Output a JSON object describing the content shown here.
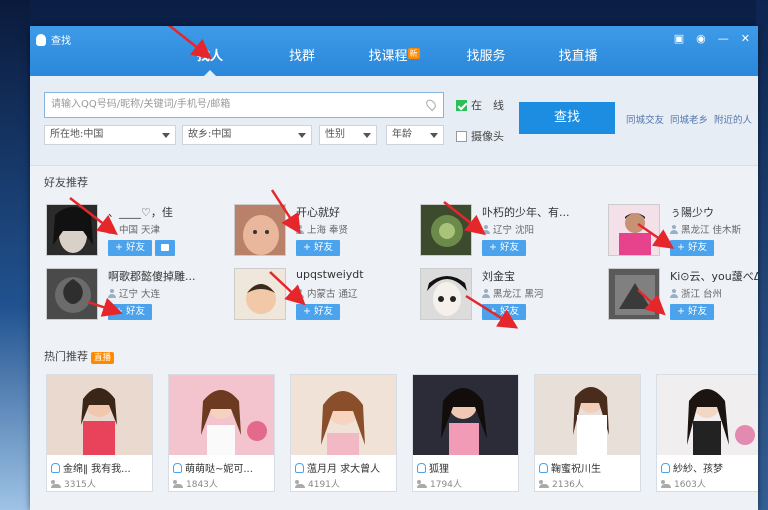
{
  "app": {
    "title": "查找"
  },
  "window_controls": [
    "▣",
    "◉",
    "—",
    "✕"
  ],
  "tabs": [
    {
      "label": "找人",
      "active": true
    },
    {
      "label": "找群",
      "active": false
    },
    {
      "label": "找课程",
      "active": false,
      "badge": "新"
    },
    {
      "label": "找服务",
      "active": false
    },
    {
      "label": "找直播",
      "active": false
    }
  ],
  "search": {
    "placeholder": "请输入QQ号码/昵称/关键词/手机号/邮箱",
    "location_select": "所在地:中国",
    "hometown_select": "故乡:中国",
    "gender_select": "性别",
    "age_select": "年龄",
    "online_label": "在　线",
    "online_checked": true,
    "camera_label": "摄像头",
    "camera_checked": false,
    "find_button": "查找",
    "quick_links": [
      "同城交友",
      "同城老乡",
      "附近的人"
    ]
  },
  "friends_section": {
    "title": "好友推荐",
    "add_label": "+ 好友",
    "friends": [
      {
        "name": "、____♡，佳",
        "location": "中国 天津",
        "has_msg": true
      },
      {
        "name": "开心就好",
        "location": "上海 奉贤",
        "has_msg": false
      },
      {
        "name": "卟朽的少年、有...",
        "location": "辽宁 沈阳",
        "has_msg": false
      },
      {
        "name": "ぅ陽少ウ",
        "location": "黑龙江 佳木斯",
        "has_msg": false
      },
      {
        "name": "啊歌郡懿傻掉雕...",
        "location": "辽宁 大连",
        "has_msg": false
      },
      {
        "name": "upqstweiydt",
        "location": "内蒙古 通辽",
        "has_msg": false
      },
      {
        "name": "刘金宝",
        "location": "黑龙江 黑河",
        "has_msg": false
      },
      {
        "name": "Ki⊙云、you蘐べΔ",
        "location": "浙江 台州",
        "has_msg": false
      }
    ]
  },
  "hot_section": {
    "title": "热门推荐",
    "badge": "直播",
    "items": [
      {
        "name": "金绵‖ 我有我...",
        "count": "3315人"
      },
      {
        "name": "萌萌哒~妮可...",
        "count": "1843人"
      },
      {
        "name": "蕰月月 求大曾人",
        "count": "4191人"
      },
      {
        "name": "狐狸",
        "count": "1794人"
      },
      {
        "name": "鞠蜜祝川生",
        "count": "2136人"
      },
      {
        "name": "紗紗、孩梦",
        "count": "1603人"
      }
    ]
  },
  "colors": {
    "title_bar": "#2b87da",
    "accent": "#1c8de0",
    "add_button": "#4aa3ec",
    "arrow": "#e5262a"
  }
}
